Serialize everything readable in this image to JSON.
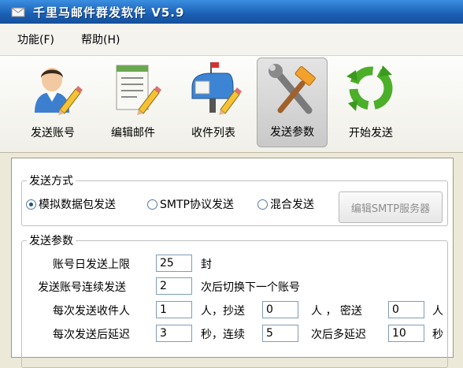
{
  "window": {
    "title": "千里马邮件群发软件   V5.9",
    "icon": "mail-app-icon"
  },
  "menu": [
    {
      "label": "功能(F)"
    },
    {
      "label": "帮助(H)"
    }
  ],
  "toolbar": [
    {
      "label": "发送账号",
      "icon": "user-pencil-icon",
      "active": false
    },
    {
      "label": "编辑邮件",
      "icon": "document-pencil-icon",
      "active": false
    },
    {
      "label": "收件列表",
      "icon": "mailbox-pencil-icon",
      "active": false
    },
    {
      "label": "发送参数",
      "icon": "wrench-hammer-icon",
      "active": true
    },
    {
      "label": "开始发送",
      "icon": "green-refresh-arrows-icon",
      "active": false
    }
  ],
  "send_method": {
    "legend": "发送方式",
    "options": [
      {
        "label": "模拟数据包发送",
        "checked": true
      },
      {
        "label": "SMTP协议发送",
        "checked": false
      },
      {
        "label": "混合发送",
        "checked": false
      }
    ],
    "edit_smtp_label": "编辑SMTP服务器"
  },
  "send_params": {
    "legend": "发送参数",
    "daily_limit": {
      "label": "账号日发送上限",
      "value": "25",
      "unit": "封"
    },
    "consecutive": {
      "label": "发送账号连续发送",
      "value": "2",
      "suffix": "次后切换下一个账号"
    },
    "recipients": {
      "label": "每次发送收件人",
      "value": "1",
      "cc_label": "人，抄送",
      "cc_value": "0",
      "bcc_label": "人 ， 密送",
      "bcc_value": "0",
      "unit": "人"
    },
    "delay": {
      "label": "每次发送后延迟",
      "value": "3",
      "mid_label": "秒，连续",
      "count_value": "5",
      "extra_label": "次后多延迟",
      "extra_value": "10",
      "unit": "秒"
    }
  },
  "colors": {
    "titlebar": "#1a5fb4",
    "menubar": "#f4f3ee",
    "input_border": "#7f9db9",
    "disabled_text": "#8e8e8e"
  }
}
